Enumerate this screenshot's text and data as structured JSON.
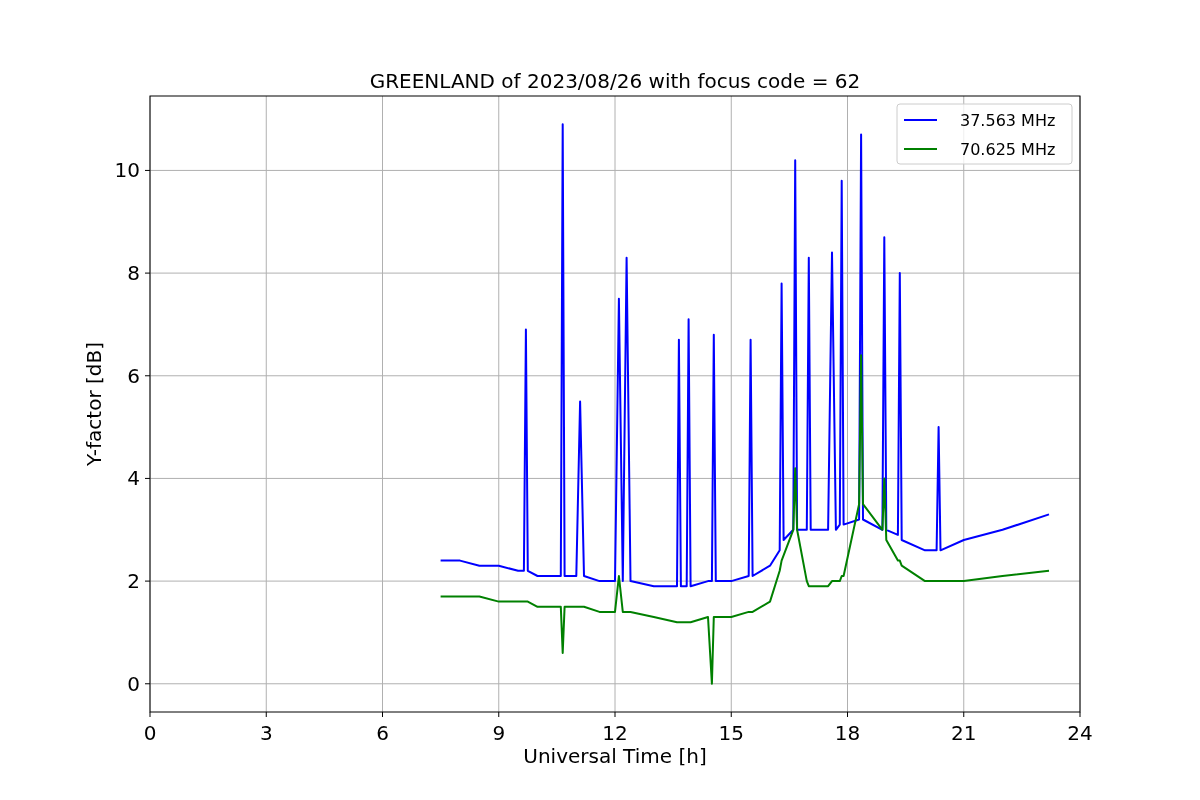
{
  "chart_data": {
    "type": "line",
    "title": "GREENLAND of 2023/08/26 with focus code = 62",
    "xlabel": "Universal Time [h]",
    "ylabel": "Y-factor [dB]",
    "xlim": [
      0,
      24
    ],
    "ylim": [
      -0.55,
      11.45
    ],
    "xticks": [
      0,
      3,
      6,
      9,
      12,
      15,
      18,
      21,
      24
    ],
    "yticks": [
      0,
      2,
      4,
      6,
      8,
      10
    ],
    "grid": true,
    "legend": true,
    "x": [
      7.5,
      8,
      8.5,
      9,
      9.5,
      9.65,
      9.7,
      9.75,
      10,
      10.6,
      10.65,
      10.7,
      11,
      11.1,
      11.2,
      11.6,
      12,
      12.1,
      12.2,
      12.3,
      12.4,
      13,
      13.6,
      13.65,
      13.7,
      13.85,
      13.9,
      13.95,
      14.4,
      14.5,
      14.55,
      14.6,
      15,
      15.45,
      15.5,
      15.55,
      16,
      16.25,
      16.3,
      16.35,
      16.6,
      16.65,
      16.7,
      16.95,
      17,
      17.05,
      17.5,
      17.6,
      17.7,
      17.8,
      17.85,
      17.9,
      18.3,
      18.35,
      18.4,
      18.9,
      18.95,
      19,
      19.3,
      19.35,
      19.4,
      20,
      20.3,
      20.35,
      20.4,
      21,
      22,
      23.2
    ],
    "series": [
      {
        "name": "37.563 MHz",
        "color": "#0000ff",
        "values": [
          2.4,
          2.4,
          2.3,
          2.3,
          2.2,
          2.2,
          6.9,
          2.2,
          2.1,
          2.1,
          10.9,
          2.1,
          2.1,
          5.5,
          2.1,
          2.0,
          2.0,
          7.5,
          2.0,
          8.3,
          2.0,
          1.9,
          1.9,
          6.7,
          1.9,
          1.9,
          7.1,
          1.9,
          2.0,
          2.0,
          6.8,
          2.0,
          2.0,
          2.1,
          6.7,
          2.1,
          2.3,
          2.6,
          7.8,
          2.8,
          3.0,
          10.2,
          3.0,
          3.0,
          8.3,
          3.0,
          3.0,
          8.4,
          3.0,
          3.1,
          9.8,
          3.1,
          3.2,
          10.7,
          3.2,
          3.0,
          8.7,
          3.0,
          2.9,
          8.0,
          2.8,
          2.6,
          2.6,
          5.0,
          2.6,
          2.8,
          3.0,
          3.3
        ]
      },
      {
        "name": "70.625 MHz",
        "color": "#008000",
        "values": [
          1.7,
          1.7,
          1.7,
          1.6,
          1.6,
          1.6,
          1.6,
          1.6,
          1.5,
          1.5,
          0.6,
          1.5,
          1.5,
          1.5,
          1.5,
          1.4,
          1.4,
          2.1,
          1.4,
          1.4,
          1.4,
          1.3,
          1.2,
          1.2,
          1.2,
          1.2,
          1.2,
          1.2,
          1.3,
          0.0,
          1.3,
          1.3,
          1.3,
          1.4,
          1.4,
          1.4,
          1.6,
          2.2,
          2.4,
          2.5,
          3.0,
          4.2,
          3.0,
          2.0,
          1.9,
          1.9,
          1.9,
          2.0,
          2.0,
          2.0,
          2.1,
          2.1,
          3.5,
          6.4,
          3.5,
          3.0,
          4.0,
          2.8,
          2.4,
          2.4,
          2.3,
          2.0,
          2.0,
          2.0,
          2.0,
          2.0,
          2.1,
          2.2
        ]
      }
    ]
  }
}
